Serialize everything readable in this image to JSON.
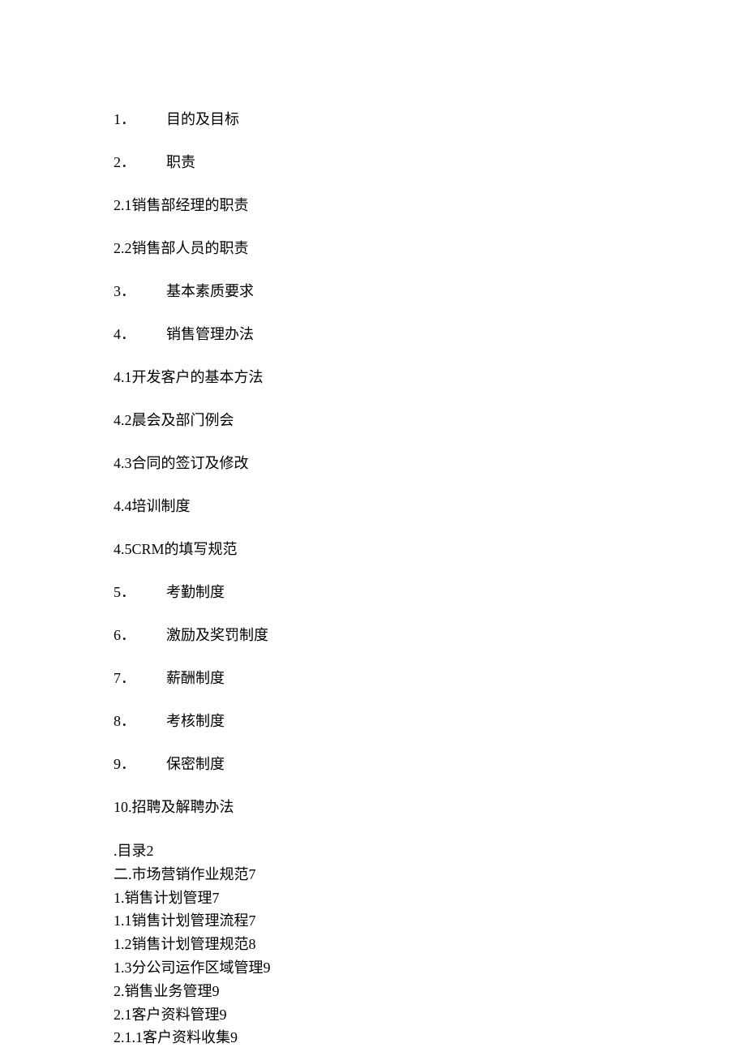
{
  "spacedItems": [
    {
      "type": "numbered",
      "number": "1．",
      "title": "目的及目标"
    },
    {
      "type": "numbered",
      "number": "2．",
      "title": "职责"
    },
    {
      "type": "plain",
      "text": "2.1销售部经理的职责"
    },
    {
      "type": "plain",
      "text": "2.2销售部人员的职责"
    },
    {
      "type": "numbered",
      "number": "3．",
      "title": "基本素质要求"
    },
    {
      "type": "numbered",
      "number": "4．",
      "title": "销售管理办法"
    },
    {
      "type": "plain",
      "text": "4.1开发客户的基本方法"
    },
    {
      "type": "plain",
      "text": "4.2晨会及部门例会"
    },
    {
      "type": "plain",
      "text": "4.3合同的签订及修改"
    },
    {
      "type": "plain",
      "text": "4.4培训制度"
    },
    {
      "type": "plain",
      "text": "4.5CRM的填写规范"
    },
    {
      "type": "numbered",
      "number": "5．",
      "title": "考勤制度"
    },
    {
      "type": "numbered",
      "number": "6．",
      "title": "激励及奖罚制度"
    },
    {
      "type": "numbered",
      "number": "7．",
      "title": "薪酬制度"
    },
    {
      "type": "numbered",
      "number": "8．",
      "title": "考核制度"
    },
    {
      "type": "numbered",
      "number": "9．",
      "title": "保密制度"
    },
    {
      "type": "plain",
      "text": "10.招聘及解聘办法"
    }
  ],
  "denseItems": [
    ".目录2",
    "二.市场营销作业规范7",
    "1.销售计划管理7",
    "1.1销售计划管理流程7",
    "1.2销售计划管理规范8",
    "1.3分公司运作区域管理9",
    "2.销售业务管理9",
    "2.1客户资料管理9",
    "2.1.1客户资料收集9"
  ]
}
